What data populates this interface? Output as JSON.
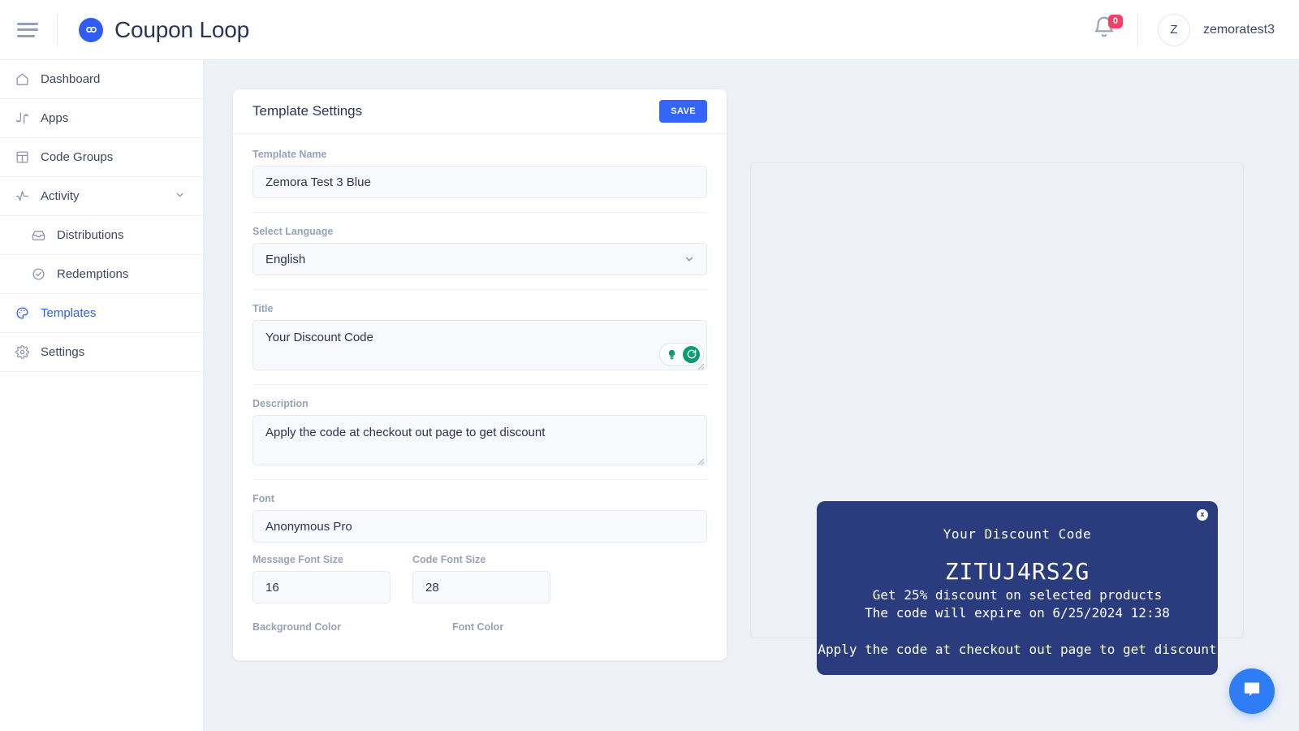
{
  "header": {
    "menu_icon": "hamburger-icon",
    "brand_name": "Coupon Loop",
    "logo_icon": "coupon-loop-logo-icon",
    "bell_icon": "notification-bell-icon",
    "notification_count": "0",
    "avatar_initial": "Z",
    "username": "zemoratest3"
  },
  "sidebar": {
    "items": [
      {
        "label": "Dashboard",
        "icon": "home-icon",
        "active": false
      },
      {
        "label": "Apps",
        "icon": "apps-icon",
        "active": false
      },
      {
        "label": "Code Groups",
        "icon": "grid-icon",
        "active": false
      },
      {
        "label": "Activity",
        "icon": "activity-icon",
        "active": false
      },
      {
        "label": "Distributions",
        "icon": "inbox-icon",
        "active": false
      },
      {
        "label": "Redemptions",
        "icon": "check-circle-icon",
        "active": false
      },
      {
        "label": "Templates",
        "icon": "palette-icon",
        "active": true
      },
      {
        "label": "Settings",
        "icon": "gear-icon",
        "active": false
      }
    ],
    "expand_icon": "chevron-down-icon",
    "active_color": "#2f5cf4"
  },
  "settings": {
    "card_title": "Template Settings",
    "save_label": "SAVE",
    "template_name_label": "Template Name",
    "template_name_value": "Zemora Test 3 Blue",
    "language_label": "Select Language",
    "language_value": "English",
    "language_chevron_icon": "chevron-down-icon",
    "title_label": "Title",
    "title_value": "Your Discount Code",
    "grammar_bulb_icon": "lightbulb-icon",
    "grammar_refresh_icon": "refresh-icon",
    "description_label": "Description",
    "description_value": "Apply the code at checkout out page to get discount",
    "font_label": "Font",
    "font_value": "Anonymous Pro",
    "message_font_size_label": "Message Font Size",
    "message_font_size_value": "16",
    "code_font_size_label": "Code Font Size",
    "code_font_size_value": "28",
    "background_color_label": "Background Color",
    "font_color_label": "Font Color"
  },
  "preview": {
    "close_icon": "close-icon",
    "close_label": "x",
    "coupon_title": "Your Discount Code",
    "coupon_code": "ZITUJ4RS2G",
    "coupon_line1": "Get 25% discount on selected products",
    "coupon_line2": "The code will expire on 6/25/2024 12:38",
    "coupon_description": "Apply the code at checkout out page to get discount",
    "background_color": "#2a3c7d",
    "font_color": "#ffffff"
  },
  "chat": {
    "icon": "chat-bubble-icon"
  }
}
